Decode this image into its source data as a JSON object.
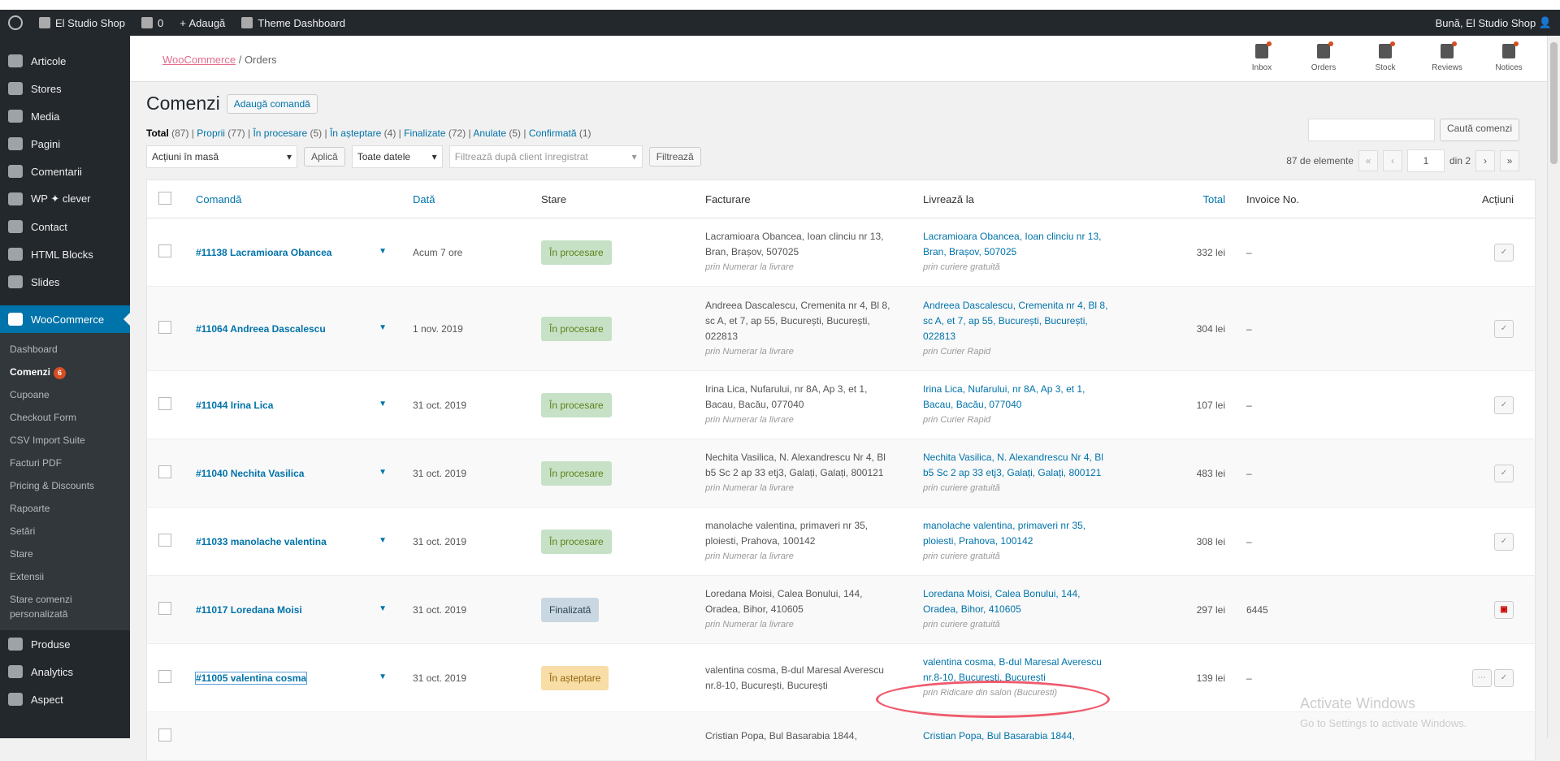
{
  "adminbar": {
    "site_name": "El Studio Shop",
    "comments_count": "0",
    "new_label": "Adaugă",
    "theme_label": "Theme Dashboard",
    "greeting": "Bună, El Studio Shop"
  },
  "sidebar": {
    "items": [
      {
        "label": "Articole"
      },
      {
        "label": "Stores"
      },
      {
        "label": "Media"
      },
      {
        "label": "Pagini"
      },
      {
        "label": "Comentarii"
      },
      {
        "label": "WP ✦ clever"
      },
      {
        "label": "Contact"
      },
      {
        "label": "HTML Blocks"
      },
      {
        "label": "Slides"
      }
    ],
    "woocommerce": "WooCommerce",
    "submenu": [
      "Dashboard",
      "Comenzi",
      "Cupoane",
      "Checkout Form",
      "CSV Import Suite",
      "Facturi PDF",
      "Pricing & Discounts",
      "Rapoarte",
      "Setări",
      "Stare",
      "Extensii",
      "Stare comenzi personalizată"
    ],
    "comenzi_badge": "6",
    "bottom": [
      {
        "label": "Produse"
      },
      {
        "label": "Analytics"
      },
      {
        "label": "Aspect"
      }
    ]
  },
  "wc_header": {
    "breadcrumb_link": "WooCommerce",
    "breadcrumb_sep": "/",
    "breadcrumb_current": "Orders",
    "icons": [
      {
        "label": "Inbox",
        "icon": "inbox-icon"
      },
      {
        "label": "Orders",
        "icon": "orders-icon"
      },
      {
        "label": "Stock",
        "icon": "stock-icon"
      },
      {
        "label": "Reviews",
        "icon": "star-icon"
      },
      {
        "label": "Notices",
        "icon": "megaphone-icon"
      }
    ]
  },
  "page": {
    "title": "Comenzi",
    "add_button": "Adaugă comandă",
    "filters": {
      "total": "Total",
      "total_count": "(87)",
      "proprii": "Proprii",
      "proprii_count": "(77)",
      "procesare": "În procesare",
      "procesare_count": "(5)",
      "asteptare": "În așteptare",
      "asteptare_count": "(4)",
      "finalizate": "Finalizate",
      "finalizate_count": "(72)",
      "anulate": "Anulate",
      "anulate_count": "(5)",
      "confirmata": "Confirmată",
      "confirmata_count": "(1)"
    },
    "search_button": "Caută comenzi",
    "bulk_select": "Acțiuni în masă",
    "apply": "Aplică",
    "dates_select": "Toate datele",
    "client_placeholder": "Filtrează după client înregistrat",
    "filter_button": "Filtrează",
    "items_count": "87 de elemente",
    "page_current": "1",
    "page_total": "din 2"
  },
  "table": {
    "headers": {
      "order": "Comandă",
      "date": "Dată",
      "status": "Stare",
      "billing": "Facturare",
      "ship": "Livrează la",
      "total": "Total",
      "invoice": "Invoice No.",
      "actions": "Acțiuni"
    },
    "rows": [
      {
        "order": "#11138 Lacramioara Obancea",
        "date": "Acum 7 ore",
        "status": "În procesare",
        "status_type": "proc",
        "billing": [
          "Lacramioara Obancea, Ioan clinciu nr 13,",
          "Bran, Brașov, 507025"
        ],
        "billing_via": "prin Numerar la livrare",
        "ship": [
          "Lacramioara Obancea, Ioan clinciu nr 13,",
          "Bran, Brașov, 507025"
        ],
        "ship_via": "prin curiere gratuită",
        "total": "332 lei",
        "invoice": "–"
      },
      {
        "order": "#11064 Andreea Dascalescu",
        "date": "1 nov. 2019",
        "status": "În procesare",
        "status_type": "proc",
        "billing": [
          "Andreea Dascalescu, Cremenita nr 4, Bl 8,",
          "sc A, et 7, ap 55, București, București,",
          "022813"
        ],
        "billing_via": "prin Numerar la livrare",
        "ship": [
          "Andreea Dascalescu, Cremenita nr 4, Bl 8,",
          "sc A, et 7, ap 55, București, București,",
          "022813"
        ],
        "ship_via": "prin Curier Rapid",
        "total": "304 lei",
        "invoice": "–"
      },
      {
        "order": "#11044 Irina Lica",
        "date": "31 oct. 2019",
        "status": "În procesare",
        "status_type": "proc",
        "billing": [
          "Irina Lica, Nufarului, nr 8A, Ap 3, et 1,",
          "Bacau, Bacău, 077040"
        ],
        "billing_via": "prin Numerar la livrare",
        "ship": [
          "Irina Lica, Nufarului, nr 8A, Ap 3, et 1,",
          "Bacau, Bacău, 077040"
        ],
        "ship_via": "prin Curier Rapid",
        "total": "107 lei",
        "invoice": "–"
      },
      {
        "order": "#11040 Nechita Vasilica",
        "date": "31 oct. 2019",
        "status": "În procesare",
        "status_type": "proc",
        "billing": [
          "Nechita Vasilica, N. Alexandrescu Nr 4, Bl",
          "b5 Sc 2 ap 33 etj3, Galați, Galați, 800121"
        ],
        "billing_via": "prin Numerar la livrare",
        "ship": [
          "Nechita Vasilica, N. Alexandrescu Nr 4, Bl",
          "b5 Sc 2 ap 33 etj3, Galați, Galați, 800121"
        ],
        "ship_via": "prin curiere gratuită",
        "total": "483 lei",
        "invoice": "–"
      },
      {
        "order": "#11033 manolache valentina",
        "date": "31 oct. 2019",
        "status": "În procesare",
        "status_type": "proc",
        "billing": [
          "manolache valentina, primaveri nr 35,",
          "ploiesti, Prahova, 100142"
        ],
        "billing_via": "prin Numerar la livrare",
        "ship": [
          "manolache valentina, primaveri nr 35,",
          "ploiesti, Prahova, 100142"
        ],
        "ship_via": "prin curiere gratuită",
        "total": "308 lei",
        "invoice": "–"
      },
      {
        "order": "#11017 Loredana Moisi",
        "date": "31 oct. 2019",
        "status": "Finalizată",
        "status_type": "fin",
        "billing": [
          "Loredana Moisi, Calea Bonului, 144,",
          "Oradea, Bihor, 410605"
        ],
        "billing_via": "prin Numerar la livrare",
        "ship": [
          "Loredana Moisi, Calea Bonului, 144,",
          "Oradea, Bihor, 410605"
        ],
        "ship_via": "prin curiere gratuită",
        "total": "297 lei",
        "invoice": "6445"
      },
      {
        "order": "#11005 valentina cosma",
        "date": "31 oct. 2019",
        "status": "În așteptare",
        "status_type": "wait",
        "billing": [
          "valentina cosma, B-dul Maresal Averescu",
          "nr.8-10, București, București"
        ],
        "billing_via": "",
        "ship": [
          "valentina cosma, B-dul Maresal Averescu",
          "nr.8-10, București, București"
        ],
        "ship_via": "prin Ridicare din salon (Bucuresti)",
        "total": "139 lei",
        "invoice": "–"
      },
      {
        "order": "",
        "date": "",
        "status": "",
        "status_type": "wait",
        "billing": [
          "Cristian Popa, Bul Basarabia 1844,"
        ],
        "billing_via": "",
        "ship": [
          "Cristian Popa, Bul Basarabia 1844,"
        ],
        "ship_via": "",
        "total": "",
        "invoice": ""
      }
    ]
  },
  "watermark": {
    "title": "Activate Windows",
    "subtitle": "Go to Settings to activate Windows."
  }
}
